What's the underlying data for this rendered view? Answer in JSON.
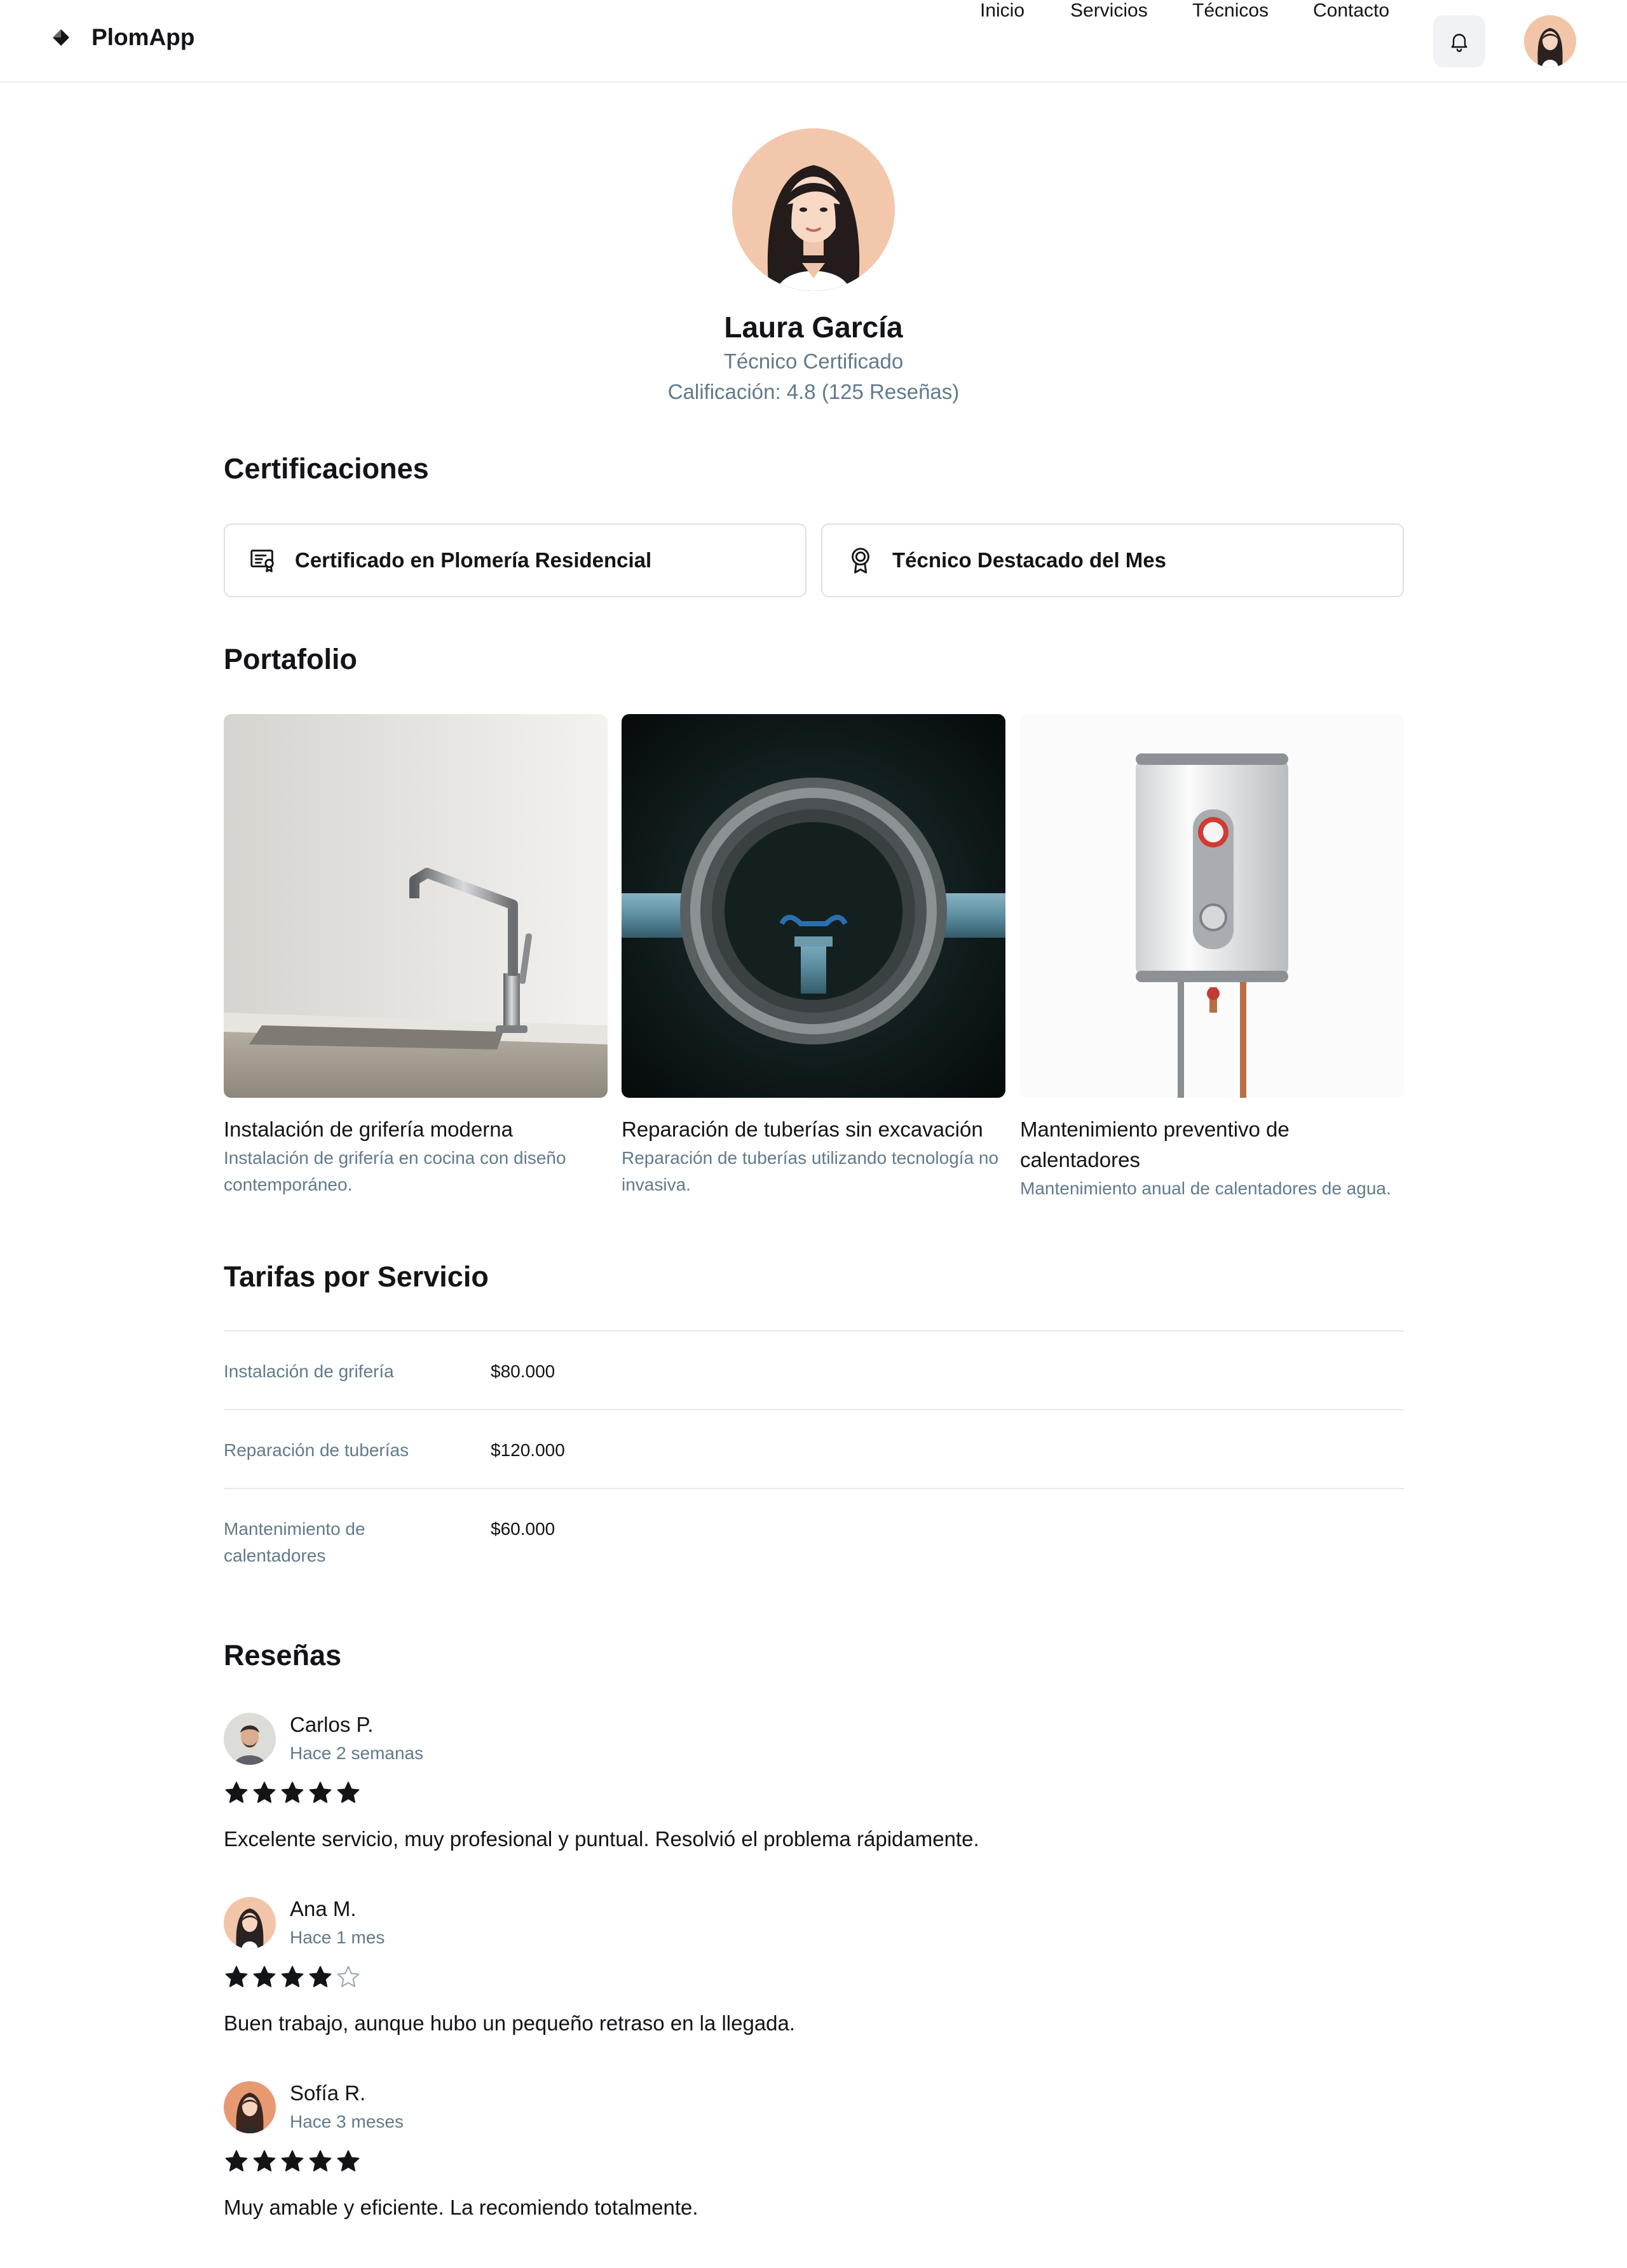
{
  "brand": {
    "name": "PlomApp"
  },
  "nav": {
    "items": [
      {
        "label": "Inicio"
      },
      {
        "label": "Servicios"
      },
      {
        "label": "Técnicos"
      },
      {
        "label": "Contacto"
      }
    ]
  },
  "header_icons": {
    "notifications": "bell-icon",
    "user": "avatar"
  },
  "profile": {
    "name": "Laura García",
    "role": "Técnico Certificado",
    "rating": "Calificación: 4.8 (125 Reseñas)"
  },
  "certifications": {
    "title": "Certificaciones",
    "items": [
      {
        "label": "Certificado en Plomería Residencial",
        "icon": "certificate-icon"
      },
      {
        "label": "Técnico Destacado del Mes",
        "icon": "award-icon"
      }
    ]
  },
  "portfolio": {
    "title": "Portafolio",
    "items": [
      {
        "title": "Instalación de grifería moderna",
        "description": "Instalación de grifería en cocina con diseño contemporáneo."
      },
      {
        "title": "Reparación de tuberías sin excavación",
        "description": "Reparación de tuberías utilizando tecnología no invasiva."
      },
      {
        "title": "Mantenimiento preventivo de calentadores",
        "description": "Mantenimiento anual de calentadores de agua."
      }
    ]
  },
  "rates": {
    "title": "Tarifas por Servicio",
    "rows": [
      {
        "service": "Instalación de grifería",
        "price": "$80.000"
      },
      {
        "service": "Reparación de tuberías",
        "price": "$120.000"
      },
      {
        "service": "Mantenimiento de calentadores",
        "price": "$60.000"
      }
    ]
  },
  "reviews": {
    "title": "Reseñas",
    "items": [
      {
        "author": "Carlos P.",
        "date": "Hace 2 semanas",
        "rating": 5,
        "text": "Excelente servicio, muy profesional y puntual. Resolvió el problema rápidamente."
      },
      {
        "author": "Ana M.",
        "date": "Hace 1 mes",
        "rating": 4,
        "text": "Buen trabajo, aunque hubo un pequeño retraso en la llegada."
      },
      {
        "author": "Sofía R.",
        "date": "Hace 3 meses",
        "rating": 5,
        "text": "Muy amable y eficiente. La recomiendo totalmente."
      }
    ]
  },
  "colors": {
    "text": "#121417",
    "muted": "#617a8c",
    "border": "#dbe0e5",
    "star": "#121417"
  }
}
